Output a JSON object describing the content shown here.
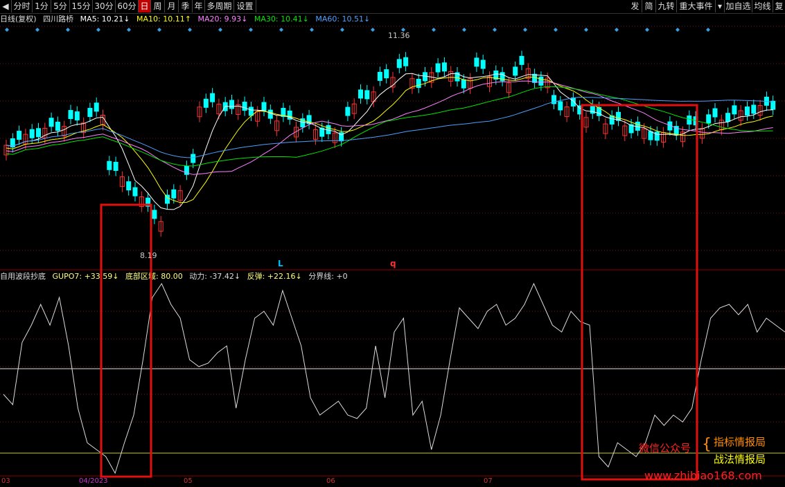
{
  "toolbar": {
    "items": [
      "分时",
      "1分",
      "5分",
      "15分",
      "30分",
      "60分",
      "日",
      "周",
      "月",
      "季",
      "年",
      "多周期",
      "设置"
    ],
    "active": "日",
    "right_items": [
      "发",
      "简",
      "九转",
      "重大事件",
      "加自选",
      "均线",
      "复"
    ]
  },
  "price_header": {
    "period": "日线(复权)",
    "name": "四川路桥",
    "ma5": "MA5: 10.21↓",
    "ma10": "MA10: 10.11↑",
    "ma20": "MA20: 9.93↓",
    "ma30": "MA30: 10.41↓",
    "ma60": "MA60: 10.51↓"
  },
  "price_labels": {
    "high": "11.36",
    "low": "8.19"
  },
  "markers": {
    "l": "L",
    "q": "q"
  },
  "indicator_header": {
    "name": "自用波段抄底",
    "gupo7": "GUPO7: +33.59↓",
    "bottom_zone": "底部区域: 80.00",
    "power": "动力: -37.42↓",
    "rebound": "反弹: +22.16↓",
    "divider": "分界线: +0"
  },
  "xaxis": [
    "03",
    "04/2023",
    "05",
    "06",
    "07"
  ],
  "watermark": {
    "wechat": "微信公众号",
    "name1": "指标情报局",
    "name2": "战法情报局",
    "url": "www.zhibiao168.com"
  },
  "colors": {
    "up": "#ff3232",
    "down": "#00ffff",
    "ma5": "#ffffff",
    "ma10": "#ffff00",
    "ma20": "#ff80ff",
    "ma30": "#00e600",
    "ma60": "#4ea0ff",
    "highlight": "#e01010"
  }
}
